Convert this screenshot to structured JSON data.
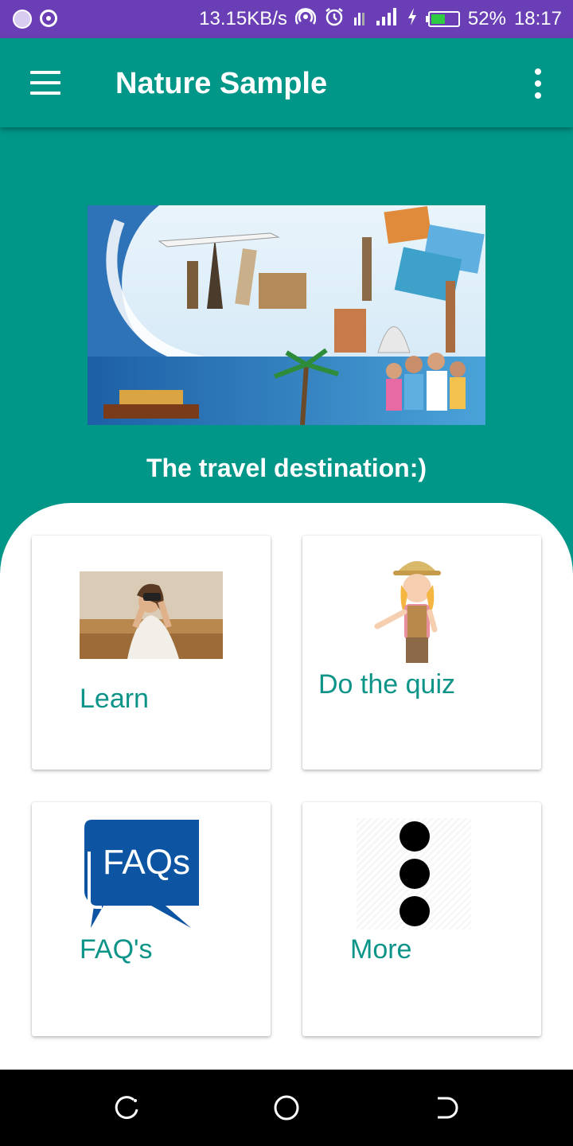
{
  "status_bar": {
    "network_speed": "13.15KB/s",
    "battery_percent": "52%",
    "battery_level": 0.52,
    "time": "18:17",
    "icons": [
      "app-notification-icon",
      "target-icon",
      "hotspot-icon",
      "alarm-icon",
      "data-signal-icon",
      "cell-signal-icon",
      "charging-icon",
      "battery-icon"
    ]
  },
  "app_bar": {
    "title": "Nature Sample",
    "background": "#009688"
  },
  "hero": {
    "subtitle": "The travel destination:)"
  },
  "cards": [
    {
      "label": "Learn",
      "icon": "binoculars-woman-photo"
    },
    {
      "label": "Do the quiz",
      "icon": "explorer-girl-illustration"
    },
    {
      "label": "FAQ's",
      "icon": "faqs-speech-bubble-icon",
      "icon_text": "FAQs"
    },
    {
      "label": "More",
      "icon": "vertical-dots-icon"
    }
  ],
  "colors": {
    "status_bar": "#6a3fb5",
    "primary": "#009688",
    "card_label": "#0c9488",
    "faq_blue": "#0d55a3"
  }
}
